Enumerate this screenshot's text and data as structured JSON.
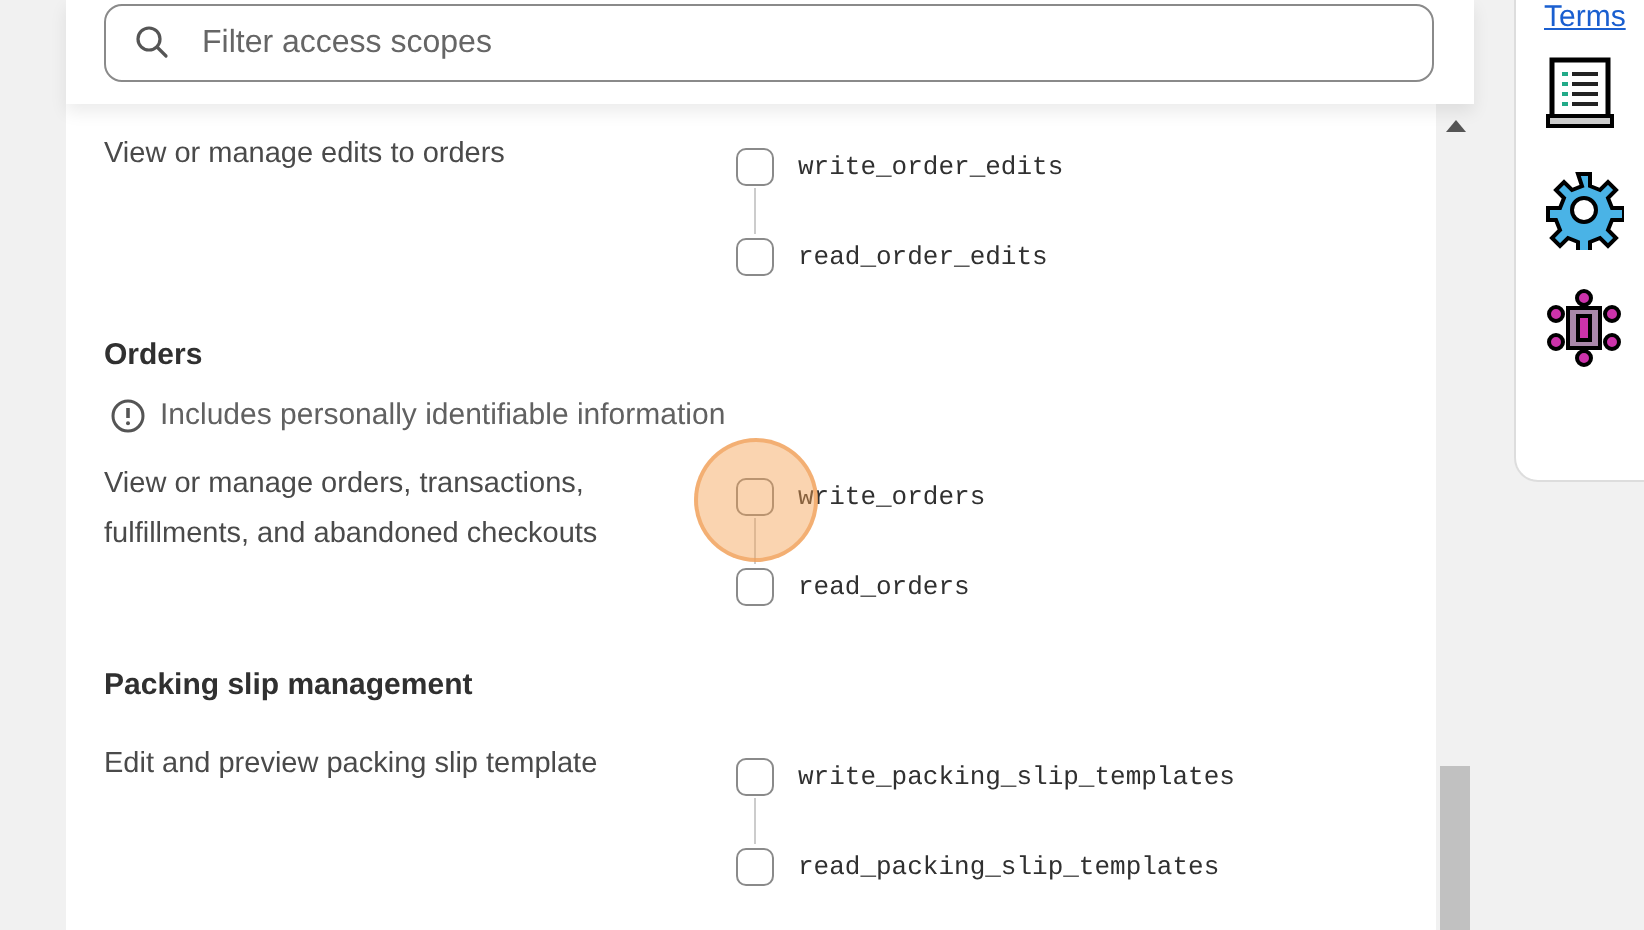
{
  "search": {
    "placeholder": "Filter access scopes"
  },
  "sections": [
    {
      "description": "View or manage edits to orders",
      "scopes": [
        {
          "name": "write_order_edits",
          "checked": false
        },
        {
          "name": "read_order_edits",
          "checked": false
        }
      ]
    },
    {
      "title": "Orders",
      "warning": "Includes personally identifiable information",
      "description": "View or manage orders, transactions, fulfillments, and abandoned checkouts",
      "scopes": [
        {
          "name": "write_orders",
          "checked": false,
          "highlighted": true
        },
        {
          "name": "read_orders",
          "checked": false
        }
      ]
    },
    {
      "title": "Packing slip management",
      "description": "Edit and preview packing slip template",
      "scopes": [
        {
          "name": "write_packing_slip_templates",
          "checked": false
        },
        {
          "name": "read_packing_slip_templates",
          "checked": false
        }
      ]
    }
  ],
  "sidebar": {
    "link": "Terms"
  }
}
